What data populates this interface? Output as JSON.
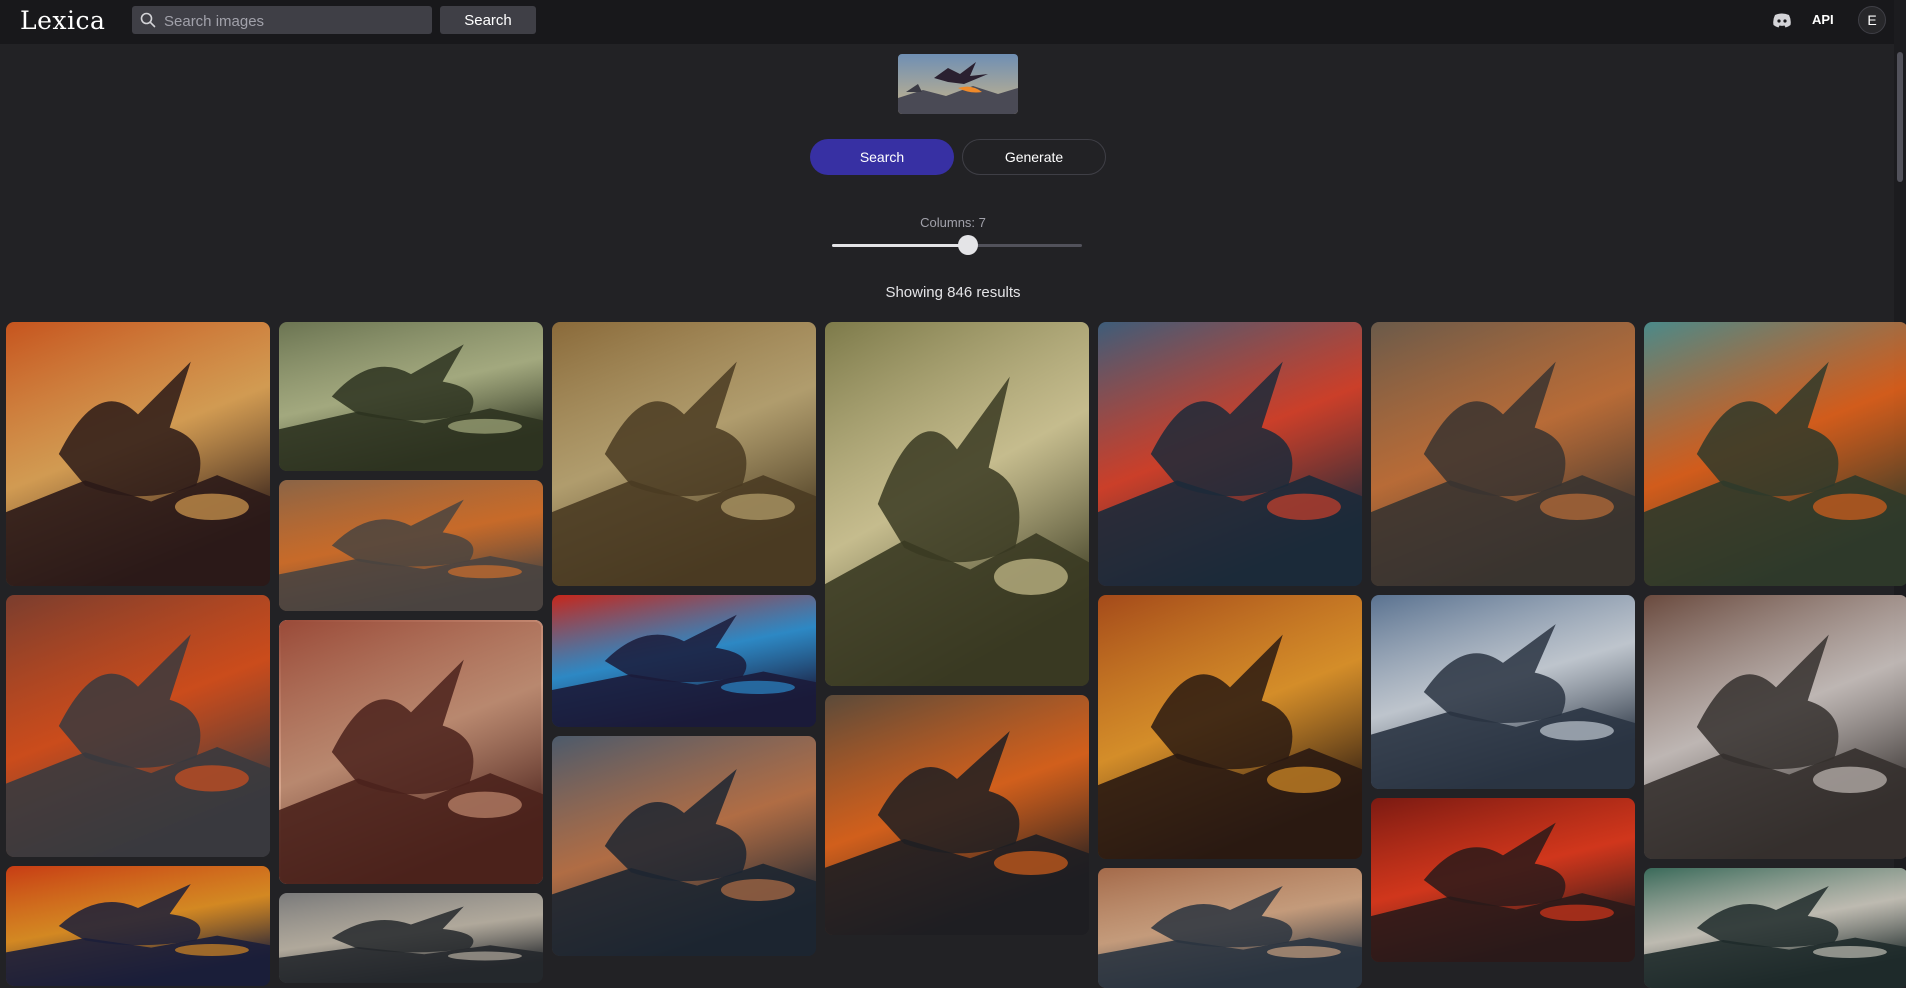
{
  "header": {
    "logo": "Lexica",
    "search_placeholder": "Search images",
    "search_button": "Search",
    "api_link": "API",
    "avatar_initial": "E"
  },
  "modes": {
    "search": "Search",
    "generate": "Generate",
    "active": "search"
  },
  "columns": {
    "label": "Columns: 7",
    "value": 7,
    "min": 1,
    "max": 12
  },
  "results": {
    "text": "Showing 846 results"
  },
  "colors": {
    "accent": "#3730a3",
    "background": "#222225",
    "topbar": "#18181b"
  },
  "gallery": {
    "columns": [
      [
        {
          "name": "red-winged-dragon-sunset",
          "tones": [
            "#2b1a18",
            "#c6541e",
            "#f0b05a"
          ]
        },
        {
          "name": "volcano-lava-dragon",
          "tones": [
            "#3a3a3e",
            "#7a3d2e",
            "#e8531a"
          ]
        },
        {
          "name": "blue-fire-godzilla",
          "tones": [
            "#1b1e3a",
            "#c73c14",
            "#f29a22"
          ]
        }
      ],
      [
        {
          "name": "serpent-dragon-mist",
          "tones": [
            "#2d3320",
            "#6b7452",
            "#b9c08e"
          ]
        },
        {
          "name": "dragons-fighting-fire",
          "tones": [
            "#4a4440",
            "#8a6446",
            "#e4772a"
          ]
        },
        {
          "name": "dinosaur-ruined-city",
          "tones": [
            "#4b221c",
            "#9a4a38",
            "#d39a7c"
          ],
          "selected": true
        },
        {
          "name": "spiked-reptile-closeup",
          "tones": [
            "#25282c",
            "#7a7a7a",
            "#c9c0b0"
          ]
        }
      ],
      [
        {
          "name": "winged-dragons-plains",
          "tones": [
            "#4a3b22",
            "#8a6a3a",
            "#c9b27a"
          ]
        },
        {
          "name": "cartoon-dragons-battle",
          "tones": [
            "#1b1b3a",
            "#c7261a",
            "#2f9ae0"
          ]
        },
        {
          "name": "dragon-stormy-sky",
          "tones": [
            "#1d2631",
            "#4c5a6b",
            "#c97a4a"
          ]
        }
      ],
      [
        {
          "name": "rider-on-raptor",
          "tones": [
            "#3a3a22",
            "#7d7a4a",
            "#e2d7a0"
          ]
        },
        {
          "name": "armored-dino-fire-breath",
          "tones": [
            "#1e1e22",
            "#5a4a3a",
            "#f06a1a"
          ]
        }
      ],
      [
        {
          "name": "blue-kaiju-laser",
          "tones": [
            "#1c2a3a",
            "#3d5d7a",
            "#e8442a"
          ]
        },
        {
          "name": "fiery-sky-dragon",
          "tones": [
            "#2a1a12",
            "#a44a1a",
            "#f3a02a"
          ]
        },
        {
          "name": "orange-dragon-head",
          "tones": [
            "#2a3440",
            "#a46a4a",
            "#e0b08a"
          ]
        }
      ],
      [
        {
          "name": "dragon-village-ruin",
          "tones": [
            "#3a3430",
            "#6a5a4a",
            "#d2783a"
          ]
        },
        {
          "name": "black-dragons-snow",
          "tones": [
            "#2a3442",
            "#5a7290",
            "#d9e1ea"
          ]
        },
        {
          "name": "godzilla-red-breath",
          "tones": [
            "#2a1a1a",
            "#7a1a12",
            "#ef3a1a"
          ]
        }
      ],
      [
        {
          "name": "teal-dinosaurs-flames",
          "tones": [
            "#2f3a2a",
            "#4a8a8a",
            "#f0661a"
          ]
        },
        {
          "name": "dragon-city-buildings",
          "tones": [
            "#35302e",
            "#6a4a3e",
            "#d9d0cc"
          ]
        },
        {
          "name": "green-dragon-flight",
          "tones": [
            "#1e2a2a",
            "#3a6a5a",
            "#d9d5c9"
          ]
        }
      ]
    ]
  }
}
